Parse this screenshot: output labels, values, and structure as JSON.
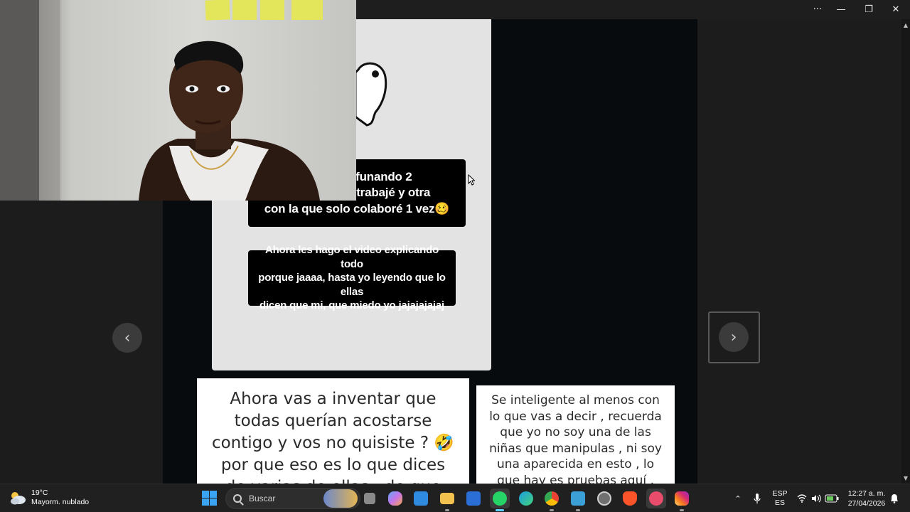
{
  "window": {
    "more_label": "···",
    "minimize_label": "—",
    "maximize_label": "❐",
    "close_label": "✕"
  },
  "story": {
    "bubble_1": "Me están funando 2\ncon una que trabajé y otra\ncon la que solo colaboré 1 vez🥴",
    "bubble_2": "Ahora les hago el video explicando todo\nporque jaaaa, hasta yo leyendo que lo ellas\ndicen que mi, que miedo yo jajajajajaj"
  },
  "nav": {
    "prev_label": "‹",
    "next_label": "›"
  },
  "quotes": {
    "quote_1": "Ahora vas a inventar que\ntodas querían acostarse\ncontigo y vos no quisiste ? 🤣\npor que eso es lo que dices\nde varias de ellas , de que",
    "quote_2": "Se inteligente al menos con\nlo que vas a decir , recuerda\nque yo no soy una de las\nniñas que manipulas , ni soy\nuna aparecida en esto , lo\nque hay es pruebas aquí ,"
  },
  "taskbar": {
    "weather_temp": "19°C",
    "weather_desc": "Mayorm. nublado",
    "search_placeholder": "Buscar",
    "apps": [
      {
        "name": "task-view",
        "color": "#8a8a8a"
      },
      {
        "name": "copilot",
        "color": "#c774e8"
      },
      {
        "name": "microsoft-store",
        "color": "#2f8be0"
      },
      {
        "name": "file-explorer",
        "color": "#f2c14e"
      },
      {
        "name": "pen-app",
        "color": "#2b6fd6"
      },
      {
        "name": "whatsapp",
        "color": "#25d366"
      },
      {
        "name": "edge",
        "color": "#1b9de2"
      },
      {
        "name": "chrome",
        "color": "#e94235"
      },
      {
        "name": "photos",
        "color": "#3aa0d6"
      },
      {
        "name": "capture",
        "color": "#707070"
      },
      {
        "name": "brave",
        "color": "#fb542b"
      },
      {
        "name": "camera-app",
        "color": "#e84c6a"
      },
      {
        "name": "instagram",
        "color": "#d62976"
      }
    ],
    "lang_top": "ESP",
    "lang_bottom": "ES",
    "time": "12:27 a. m.",
    "date": "27/04/2026"
  }
}
